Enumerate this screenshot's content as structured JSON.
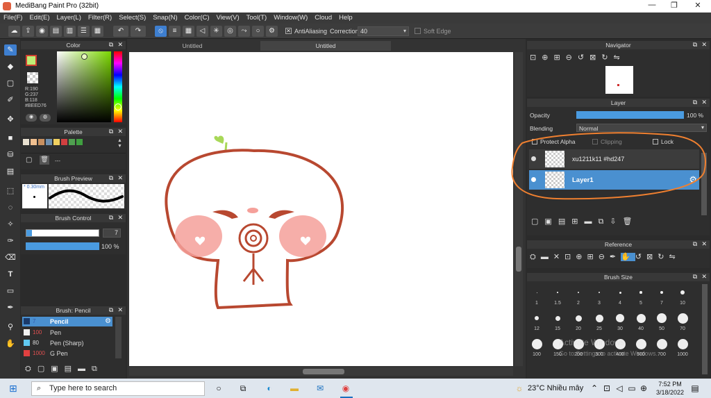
{
  "app": {
    "title": "MediBang Paint Pro (32bit)"
  },
  "window_controls": {
    "minimize": "—",
    "maximize": "❐",
    "close": "✕"
  },
  "menu": [
    "File(F)",
    "Edit(E)",
    "Layer(L)",
    "Filter(R)",
    "Select(S)",
    "Snap(N)",
    "Color(C)",
    "View(V)",
    "Tool(T)",
    "Window(W)",
    "Cloud",
    "Help"
  ],
  "toolbar": {
    "antialiasing": "AntiAliasing",
    "correction_label": "Correction",
    "correction_value": "40",
    "soft_edge": "Soft Edge"
  },
  "tabs": [
    "Untitled",
    "Untitled"
  ],
  "color_panel": {
    "title": "Color",
    "r": "R:190",
    "g": "G:237",
    "b": "B:118",
    "hex": "#BEED76",
    "fg": "#BEED76"
  },
  "palette": {
    "title": "Palette",
    "colors": [
      "#e8e0d0",
      "#f0c090",
      "#c89060",
      "#7090b0",
      "#f0d060",
      "#d04040",
      "#50a050",
      "#40a040"
    ],
    "entry": "---"
  },
  "brush_preview": {
    "title": "Brush Preview",
    "size": "0.30mm"
  },
  "brush_control": {
    "title": "Brush Control",
    "size": "7",
    "opacity": "100 %"
  },
  "brush_list": {
    "title": "Brush: Pencil",
    "items": [
      {
        "size": "7",
        "name": "Pencil",
        "color": "#1a3a6a",
        "selected": true
      },
      {
        "size": "100",
        "name": "Pen",
        "color": "#f0f0f0",
        "selected": false
      },
      {
        "size": "80",
        "name": "Pen (Sharp)",
        "color": "#60c8f0",
        "selected": false
      },
      {
        "size": "1000",
        "name": "G Pen",
        "color": "#e04040",
        "selected": false
      }
    ]
  },
  "navigator": {
    "title": "Navigator"
  },
  "layer_panel": {
    "title": "Layer",
    "opacity_label": "Opacity",
    "opacity_value": "100 %",
    "opacity_pct": 100,
    "blending_label": "Blending",
    "blending_value": "Normal",
    "protect_alpha": "Protect Alpha",
    "clipping": "Clipping",
    "lock": "Lock",
    "layers": [
      {
        "name": "xu1211k11 #hd247",
        "selected": false
      },
      {
        "name": "Layer1",
        "selected": true
      }
    ]
  },
  "reference": {
    "title": "Reference"
  },
  "brush_size": {
    "title": "Brush Size",
    "sizes": [
      "1",
      "1.5",
      "2",
      "3",
      "4",
      "5",
      "7",
      "10",
      "12",
      "15",
      "20",
      "25",
      "30",
      "40",
      "50",
      "70",
      "100",
      "150",
      "200",
      "300",
      "400",
      "500",
      "700",
      "1000"
    ]
  },
  "watermark": {
    "line1": "Activate Windows",
    "line2": "Go to Settings to activate Windows."
  },
  "taskbar": {
    "search_placeholder": "Type here to search",
    "weather": "23°C  Nhiều mây",
    "time": "7:52 PM",
    "date": "3/18/2022"
  }
}
